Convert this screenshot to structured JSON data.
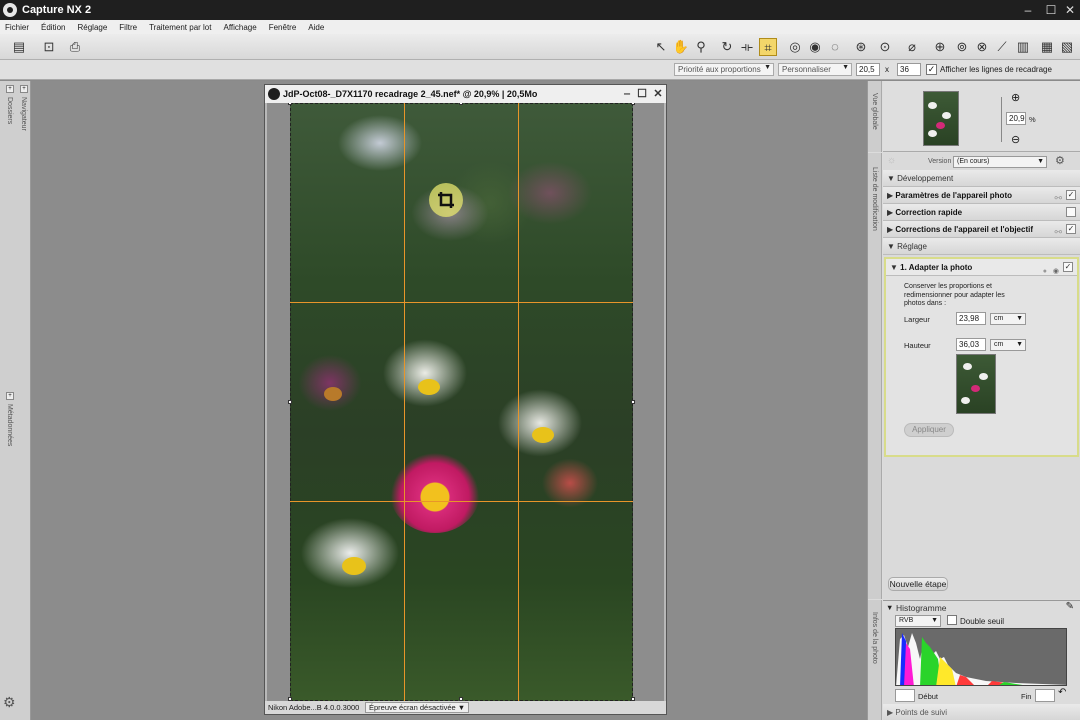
{
  "app": {
    "title": "Capture NX 2"
  },
  "window_controls": {
    "minimize": "‒",
    "maximize": "☐",
    "close": "✕"
  },
  "menu": [
    "Fichier",
    "Édition",
    "Réglage",
    "Filtre",
    "Traitement par lot",
    "Affichage",
    "Fenêtre",
    "Aide"
  ],
  "toolbar": {
    "left_tools": [
      "browser-toggle-icon",
      "zoom-photo-icon",
      "print-icon"
    ],
    "tools": [
      "direct-select-icon",
      "hand-icon",
      "zoom-icon",
      "rotate-icon",
      "straighten-icon",
      "crop-icon",
      "red-eye-icon",
      "auto-retouch-icon",
      "lasso-icon",
      "color-picker-icon",
      "dodge-icon",
      "selection-brush-icon",
      "selection-control-point-icon",
      "color-control-point-icon",
      "black-control-point-icon",
      "white-control-point-icon",
      "gradient-icon",
      "fill-icon",
      "erase-icon"
    ]
  },
  "options_bar": {
    "priority": "Priorité aux proportions",
    "preset": "Personnaliser",
    "ratio_w": "20,5",
    "x": "x",
    "ratio_h": "36",
    "show_lines_label": "Afficher les lignes de recadrage",
    "show_lines_checked": "✓"
  },
  "left_tabs": {
    "folders": "Dossiers",
    "navigator": "Navigateur",
    "metadata": "Métadonnées"
  },
  "image_window": {
    "title": "JdP-Oct08-_D7X1170 recadrage 2_45.nef* @ 20,9% | 20,5Mo",
    "status_profile": "Nikon Adobe...B 4.0.0.3000",
    "status_proof": "Épreuve écran désactivée"
  },
  "overview": {
    "tab": "Vue globale",
    "zoom_value": "20,9",
    "zoom_unit": "%"
  },
  "edit_list": {
    "tab": "Liste de modification",
    "version_label": "Version",
    "version_value": "(En cours)",
    "sections": {
      "development": "Développement",
      "camera_settings": "Paramètres de l'appareil photo",
      "quick_fix": "Correction rapide",
      "camera_lens": "Corrections de l'appareil et l'objectif",
      "adjust": "Réglage"
    },
    "step": {
      "title": "1. Adapter la photo",
      "description": "Conserver les proportions et redimensionner pour adapter les photos dans :",
      "width_label": "Largeur",
      "width_value": "23,98",
      "width_unit": "cm",
      "height_label": "Hauteur",
      "height_value": "36,03",
      "height_unit": "cm",
      "apply": "Appliquer"
    },
    "new_step": "Nouvelle étape"
  },
  "histogram": {
    "tab": "Infos de la photo",
    "title": "Histogramme",
    "channel": "RVB",
    "double_threshold": "Double seuil",
    "start_label": "Début",
    "end_label": "Fin"
  },
  "watch_points": "Points de suivi"
}
